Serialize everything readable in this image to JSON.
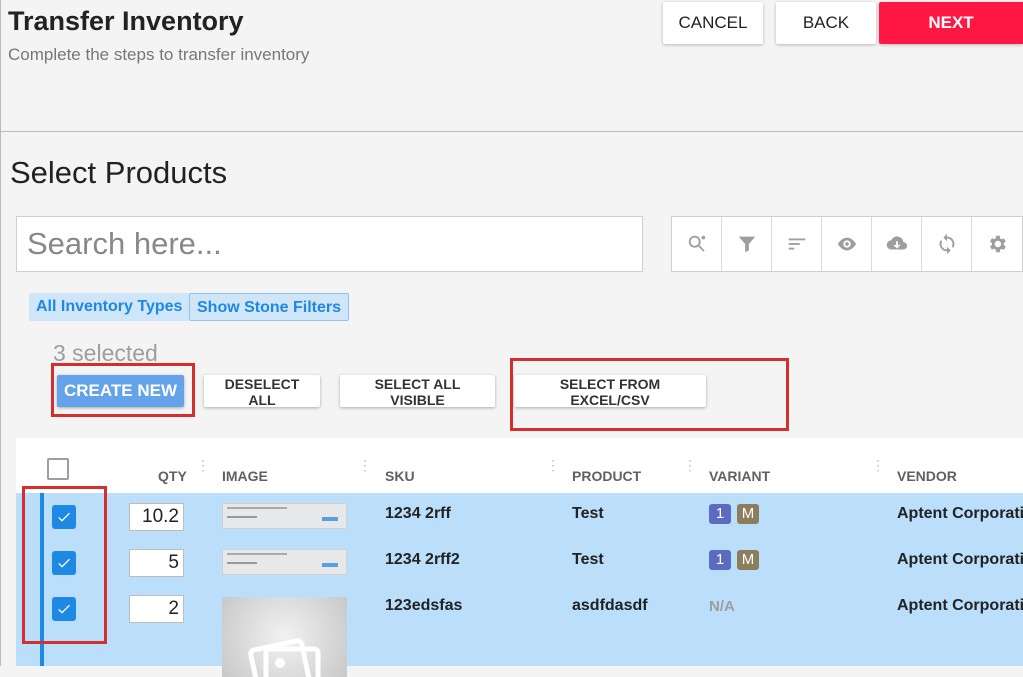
{
  "header": {
    "title": "Transfer Inventory",
    "subtitle": "Complete the steps to transfer inventory",
    "cancel_label": "CANCEL",
    "back_label": "BACK",
    "next_label": "NEXT"
  },
  "section": {
    "title": "Select Products"
  },
  "search": {
    "placeholder": "Search here..."
  },
  "toolbar": {
    "icons": [
      "advanced-search-icon",
      "filter-icon",
      "sort-icon",
      "eye-icon",
      "cloud-download-icon",
      "refresh-icon",
      "gear-icon"
    ]
  },
  "chips": {
    "inventory_types": "All Inventory Types",
    "stone_filters": "Show Stone Filters"
  },
  "selection": {
    "count_text": "3 selected"
  },
  "actions": {
    "create_new": "CREATE NEW",
    "deselect_all": "DESELECT ALL",
    "select_all_visible": "SELECT ALL VISIBLE",
    "select_from_excel": "SELECT FROM EXCEL/CSV"
  },
  "table": {
    "headers": {
      "qty": "QTY",
      "image": "IMAGE",
      "sku": "SKU",
      "product": "PRODUCT",
      "variant": "VARIANT",
      "vendor": "VENDOR"
    },
    "rows": [
      {
        "qty": "10.2",
        "sku": "1234 2rff",
        "product": "Test",
        "variant": [
          "1",
          "M"
        ],
        "vendor": "Aptent Corporation"
      },
      {
        "qty": "5",
        "sku": "1234 2rff2",
        "product": "Test",
        "variant": [
          "1",
          "M"
        ],
        "vendor": "Aptent Corporation"
      },
      {
        "qty": "2",
        "sku": "123edsfas",
        "product": "asdfdasdf",
        "variant_text": "N/A",
        "vendor": "Aptent Corporation"
      }
    ]
  },
  "colors": {
    "accent": "#1e88e5",
    "next_button": "#ff1744",
    "create_button": "#64a2ea",
    "selected_row": "#bbdefb",
    "highlight_box": "#d32f2f"
  }
}
